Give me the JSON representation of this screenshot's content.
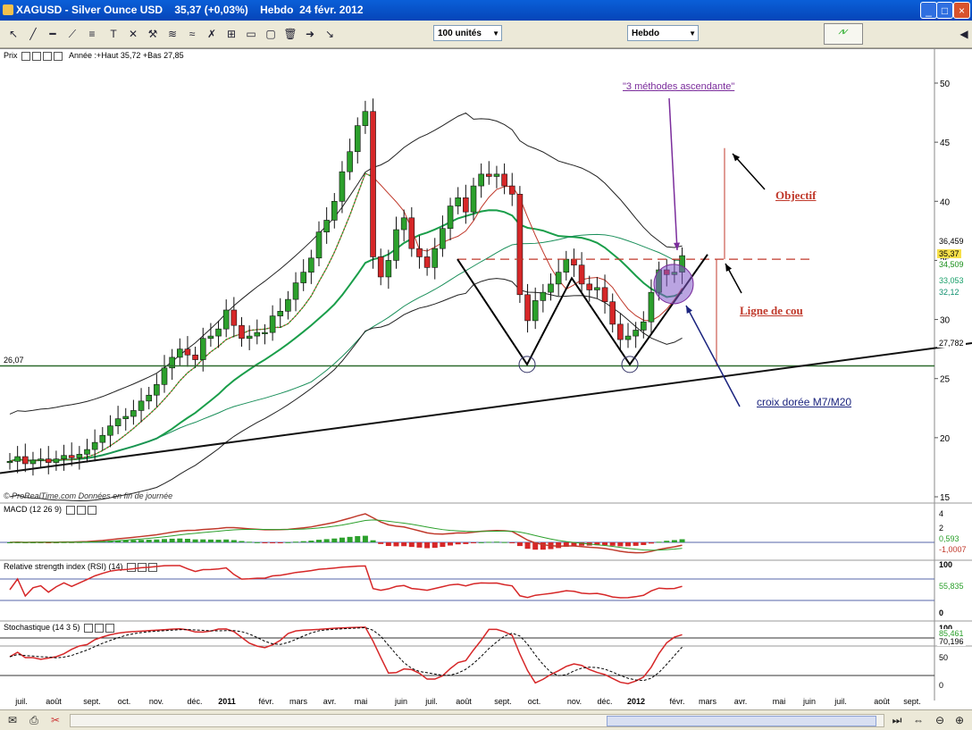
{
  "window": {
    "title": "XAGUSD - Silver Ounce USD    35,37 (+0,03%)    Hebdo  24 févr. 2012"
  },
  "toolbar": {
    "units_select": "100 unités",
    "period_select": "Hebdo"
  },
  "price_panel": {
    "header": "Prix",
    "info": "Année :+Haut 35,72 +Bas 27,85",
    "copyright": "© ProRealTime.com  Données en fin de journée",
    "last_values": [
      "36,459",
      "35,37",
      "34,509",
      "33,053",
      "32,12",
      "27,782"
    ],
    "support_label": "26,07"
  },
  "annotations": {
    "three_methods": "\"3 méthodes ascendante\"",
    "objectif": "Objectif",
    "neckline": "Ligne de cou",
    "golden_cross": "croix dorée M7/M20"
  },
  "macd_panel": {
    "header": "MACD (12 26 9)",
    "ticks": [
      "4",
      "2",
      "0"
    ],
    "values": [
      "0,593",
      "-1,0007"
    ]
  },
  "rsi_panel": {
    "header": "Relative strength index (RSI) (14)",
    "ticks": [
      "100",
      "0"
    ],
    "value": "55,835"
  },
  "stoch_panel": {
    "header": "Stochastique (14 3 5)",
    "ticks": [
      "100",
      "50",
      "0"
    ],
    "values": [
      "85,461",
      "70,196"
    ]
  },
  "colors": {
    "up": "#2ca02c",
    "down": "#d62728",
    "macd": "#c0392b",
    "signal": "#2ca02c",
    "neckline": "#c0392b"
  },
  "chart_data": {
    "type": "candlestick",
    "title": "XAGUSD - Silver Ounce USD",
    "period": "weekly",
    "y_ticks": [
      15,
      20,
      25,
      30,
      35,
      40,
      45,
      50
    ],
    "ylim": [
      14.5,
      51.5
    ],
    "x_labels": [
      "juil.",
      "août",
      "sept.",
      "oct.",
      "nov.",
      "déc.",
      "2011",
      "févr.",
      "mars",
      "avr.",
      "mai",
      "juin",
      "juil.",
      "août",
      "sept.",
      "oct.",
      "nov.",
      "déc.",
      "2012",
      "févr.",
      "mars",
      "avr.",
      "mai",
      "juin",
      "juil.",
      "août",
      "sept."
    ],
    "close": [
      18.0,
      18.4,
      17.8,
      18.1,
      18.2,
      17.9,
      18.2,
      18.5,
      18.3,
      18.6,
      19.0,
      19.6,
      20.2,
      21.0,
      21.6,
      21.8,
      22.3,
      23.1,
      23.6,
      24.5,
      25.9,
      26.8,
      27.5,
      27.0,
      26.6,
      28.4,
      28.6,
      29.2,
      30.8,
      29.5,
      28.4,
      28.6,
      28.9,
      28.9,
      30.3,
      30.7,
      31.7,
      33.1,
      34.0,
      35.2,
      37.4,
      38.4,
      40.0,
      42.5,
      44.2,
      46.4,
      47.6,
      35.3,
      33.6,
      35.0,
      37.6,
      38.6,
      36.0,
      35.3,
      34.4,
      36.0,
      37.7,
      39.6,
      40.3,
      39.1,
      41.3,
      42.3,
      42.1,
      42.3,
      41.3,
      40.6,
      32.1,
      29.9,
      31.6,
      32.3,
      33.0,
      34.0,
      35.1,
      34.6,
      33.0,
      32.5,
      32.7,
      31.5,
      29.6,
      28.3,
      28.6,
      29.1,
      29.8,
      32.3,
      34.2,
      33.8,
      34.0,
      35.4
    ],
    "support": 26.07,
    "neckline": 35.1,
    "objective": 44.5
  }
}
